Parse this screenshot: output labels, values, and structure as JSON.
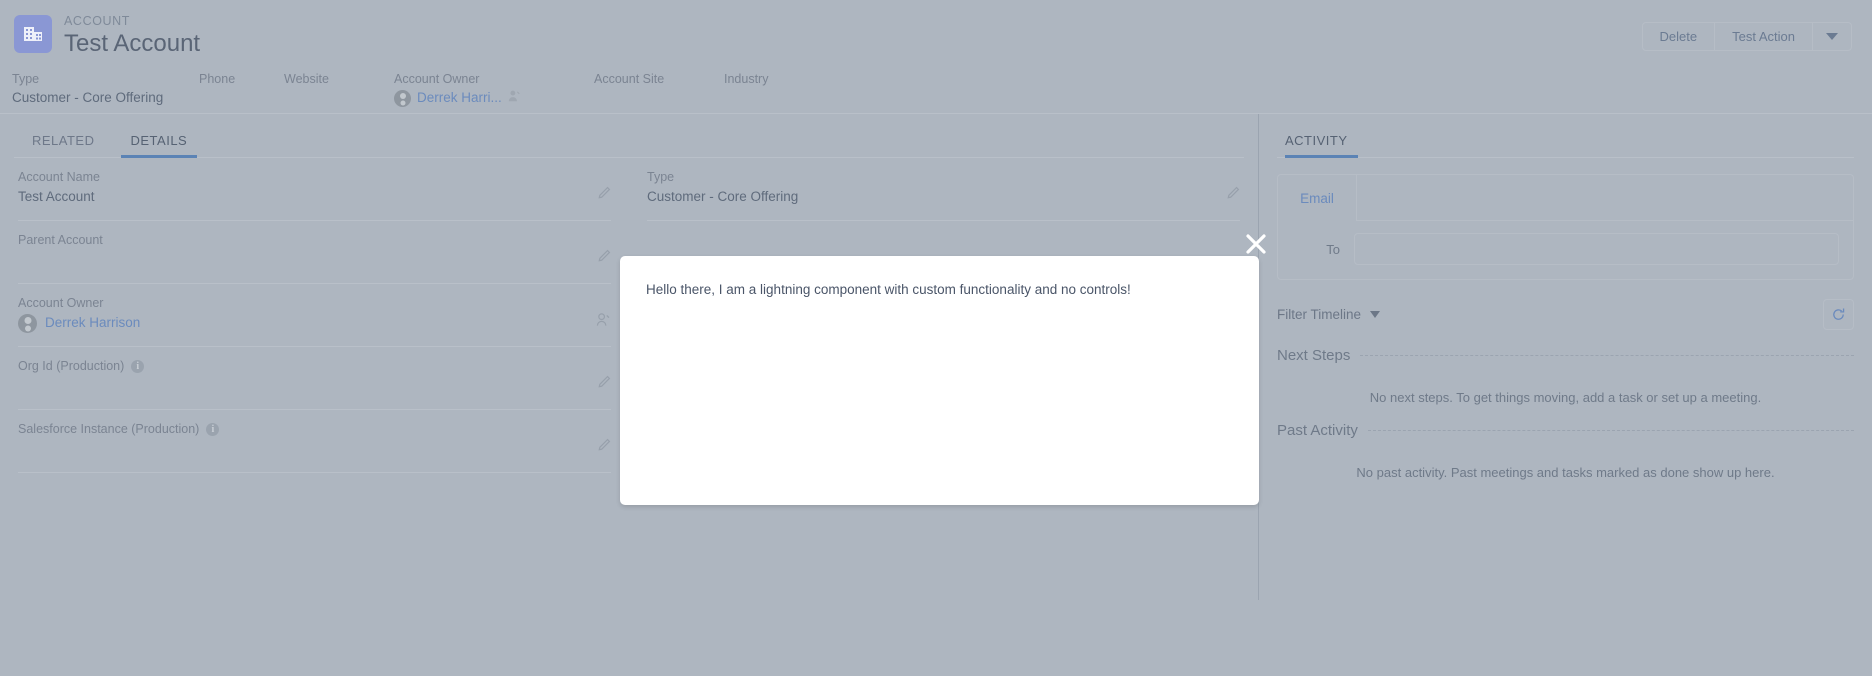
{
  "header": {
    "object_label": "ACCOUNT",
    "record_name": "Test Account",
    "icon": "account-building-icon",
    "icon_color": "#8a97d4",
    "actions": {
      "delete_label": "Delete",
      "test_action_label": "Test Action",
      "more_icon": "caret-down-icon"
    }
  },
  "highlights": [
    {
      "label": "Type",
      "value": "Customer - Core Offering"
    },
    {
      "label": "Phone",
      "value": ""
    },
    {
      "label": "Website",
      "value": ""
    },
    {
      "label": "Account Owner",
      "value": "Derrek Harri..."
    },
    {
      "label": "Account Site",
      "value": ""
    },
    {
      "label": "Industry",
      "value": ""
    }
  ],
  "left_panel": {
    "tabs": [
      {
        "label": "RELATED",
        "active": false
      },
      {
        "label": "DETAILS",
        "active": true
      }
    ],
    "fields_left": [
      {
        "label": "Account Name",
        "value": "Test Account",
        "info": false,
        "link": false,
        "avatar": false
      },
      {
        "label": "Parent Account",
        "value": "",
        "info": false,
        "link": false,
        "avatar": false
      },
      {
        "label": "Account Owner",
        "value": "Derrek Harrison",
        "info": false,
        "link": true,
        "avatar": true
      },
      {
        "label": "Org Id (Production)",
        "value": "",
        "info": true,
        "link": false,
        "avatar": false
      },
      {
        "label": "Salesforce Instance (Production)",
        "value": "",
        "info": true,
        "link": false,
        "avatar": false
      }
    ],
    "fields_right": [
      {
        "label": "Type",
        "value": "Customer - Core Offering",
        "info": false,
        "link": false,
        "avatar": false
      }
    ]
  },
  "activity_panel": {
    "tab_label": "ACTIVITY",
    "composer": {
      "tab_label": "Email",
      "to_label": "To",
      "to_value": "",
      "to_placeholder": ""
    },
    "filter_label": "Filter Timeline",
    "refresh_icon": "refresh-icon",
    "next_steps_title": "Next Steps",
    "next_steps_empty": "No next steps. To get things moving, add a task or set up a meeting.",
    "past_activity_title": "Past Activity",
    "past_activity_empty": "No past activity. Past meetings and tasks marked as done show up here."
  },
  "modal": {
    "message": "Hello there, I am a lightning component with custom functionality and no controls!",
    "close_icon": "close-x-icon"
  },
  "colors": {
    "accent": "#5b83b5",
    "link": "#6b8bbd",
    "overlay": "#aeb6c0",
    "modal_bg": "#ffffff"
  }
}
